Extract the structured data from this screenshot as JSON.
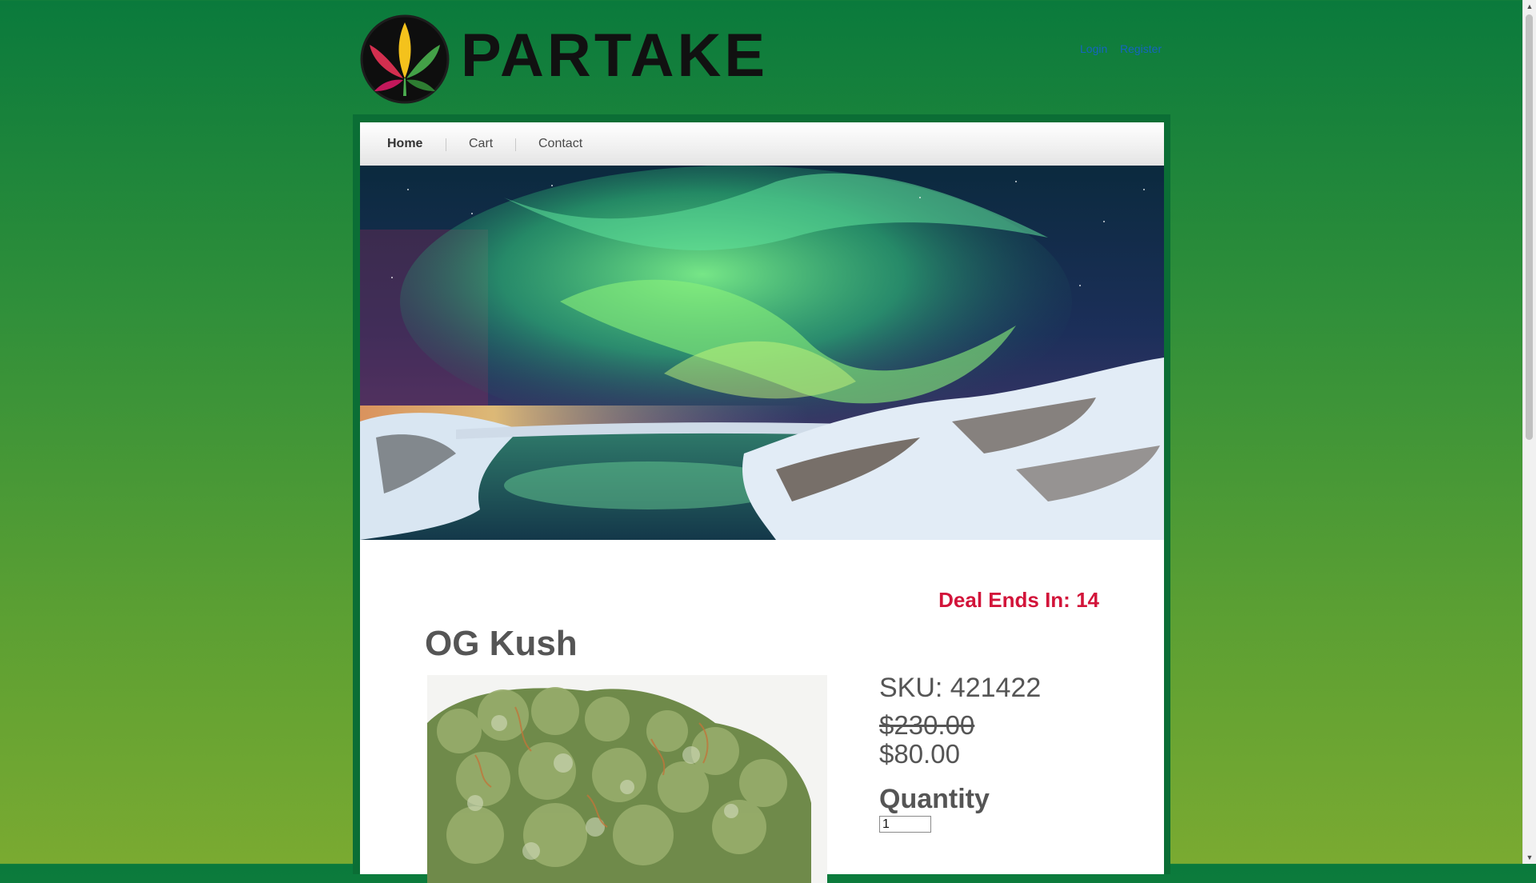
{
  "header": {
    "brand": "PARTAKE",
    "account_links": {
      "login": "Login",
      "register": "Register"
    }
  },
  "nav": {
    "items": [
      {
        "label": "Home",
        "active": true
      },
      {
        "label": "Cart",
        "active": false
      },
      {
        "label": "Contact",
        "active": false
      }
    ]
  },
  "banner": {
    "icon": "aurora-landscape-photo"
  },
  "product": {
    "deal_label": "Deal Ends In:",
    "deal_value": "14",
    "name": "OG Kush",
    "image_icon": "cannabis-bud-photo",
    "sku": "SKU: 421422",
    "price_original": "$230.00",
    "price_sale": "$80.00",
    "quantity_label": "Quantity",
    "quantity_value": "1"
  },
  "colors": {
    "background_top": "#0a7a3c",
    "background_bottom": "#7aaa31",
    "frame": "#0b6e35",
    "deal_text": "#d2143a",
    "link": "#1565c0"
  }
}
